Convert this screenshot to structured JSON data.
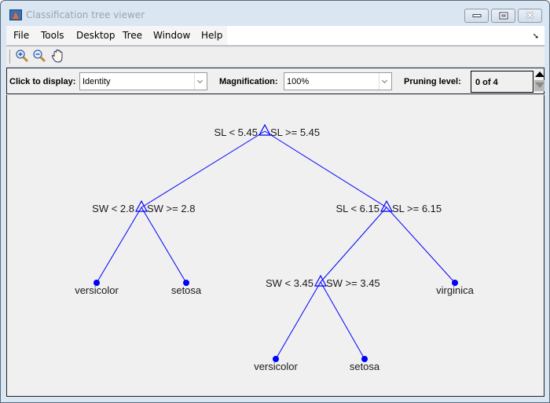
{
  "window": {
    "title": "Classification tree viewer",
    "controls": [
      "minimize",
      "maximize",
      "close"
    ]
  },
  "menubar": {
    "items": [
      "File",
      "Tools",
      "Desktop",
      "Tree",
      "Window",
      "Help"
    ]
  },
  "toolbar": {
    "buttons": [
      {
        "name": "zoom-in",
        "icon": "zoom-in-icon"
      },
      {
        "name": "zoom-out",
        "icon": "zoom-out-icon"
      },
      {
        "name": "pan",
        "icon": "hand-icon"
      }
    ]
  },
  "controls": {
    "display_label": "Click to display:",
    "display_value": "Identity",
    "magnification_label": "Magnification:",
    "magnification_value": "100%",
    "pruning_label": "Pruning level:",
    "pruning_value": "0 of 4"
  },
  "colors": {
    "tree_line": "#0000ff",
    "leaf_dot": "#0000ff"
  },
  "tree": {
    "nodes": [
      {
        "id": "n1",
        "type": "split",
        "left_rule": "SL < 5.45",
        "right_rule": "SL >= 5.45"
      },
      {
        "id": "n2",
        "type": "split",
        "left_rule": "SW < 2.8",
        "right_rule": "SW >= 2.8"
      },
      {
        "id": "n3",
        "type": "split",
        "left_rule": "SL < 6.15",
        "right_rule": "SL >= 6.15"
      },
      {
        "id": "n4",
        "type": "leaf",
        "label": "versicolor"
      },
      {
        "id": "n5",
        "type": "leaf",
        "label": "setosa"
      },
      {
        "id": "n6",
        "type": "split",
        "left_rule": "SW < 3.45",
        "right_rule": "SW >= 3.45"
      },
      {
        "id": "n7",
        "type": "leaf",
        "label": "virginica"
      },
      {
        "id": "n8",
        "type": "leaf",
        "label": "versicolor"
      },
      {
        "id": "n9",
        "type": "leaf",
        "label": "setosa"
      }
    ],
    "edges": [
      [
        "n1",
        "n2"
      ],
      [
        "n1",
        "n3"
      ],
      [
        "n2",
        "n4"
      ],
      [
        "n2",
        "n5"
      ],
      [
        "n3",
        "n6"
      ],
      [
        "n3",
        "n7"
      ],
      [
        "n6",
        "n8"
      ],
      [
        "n6",
        "n9"
      ]
    ]
  }
}
